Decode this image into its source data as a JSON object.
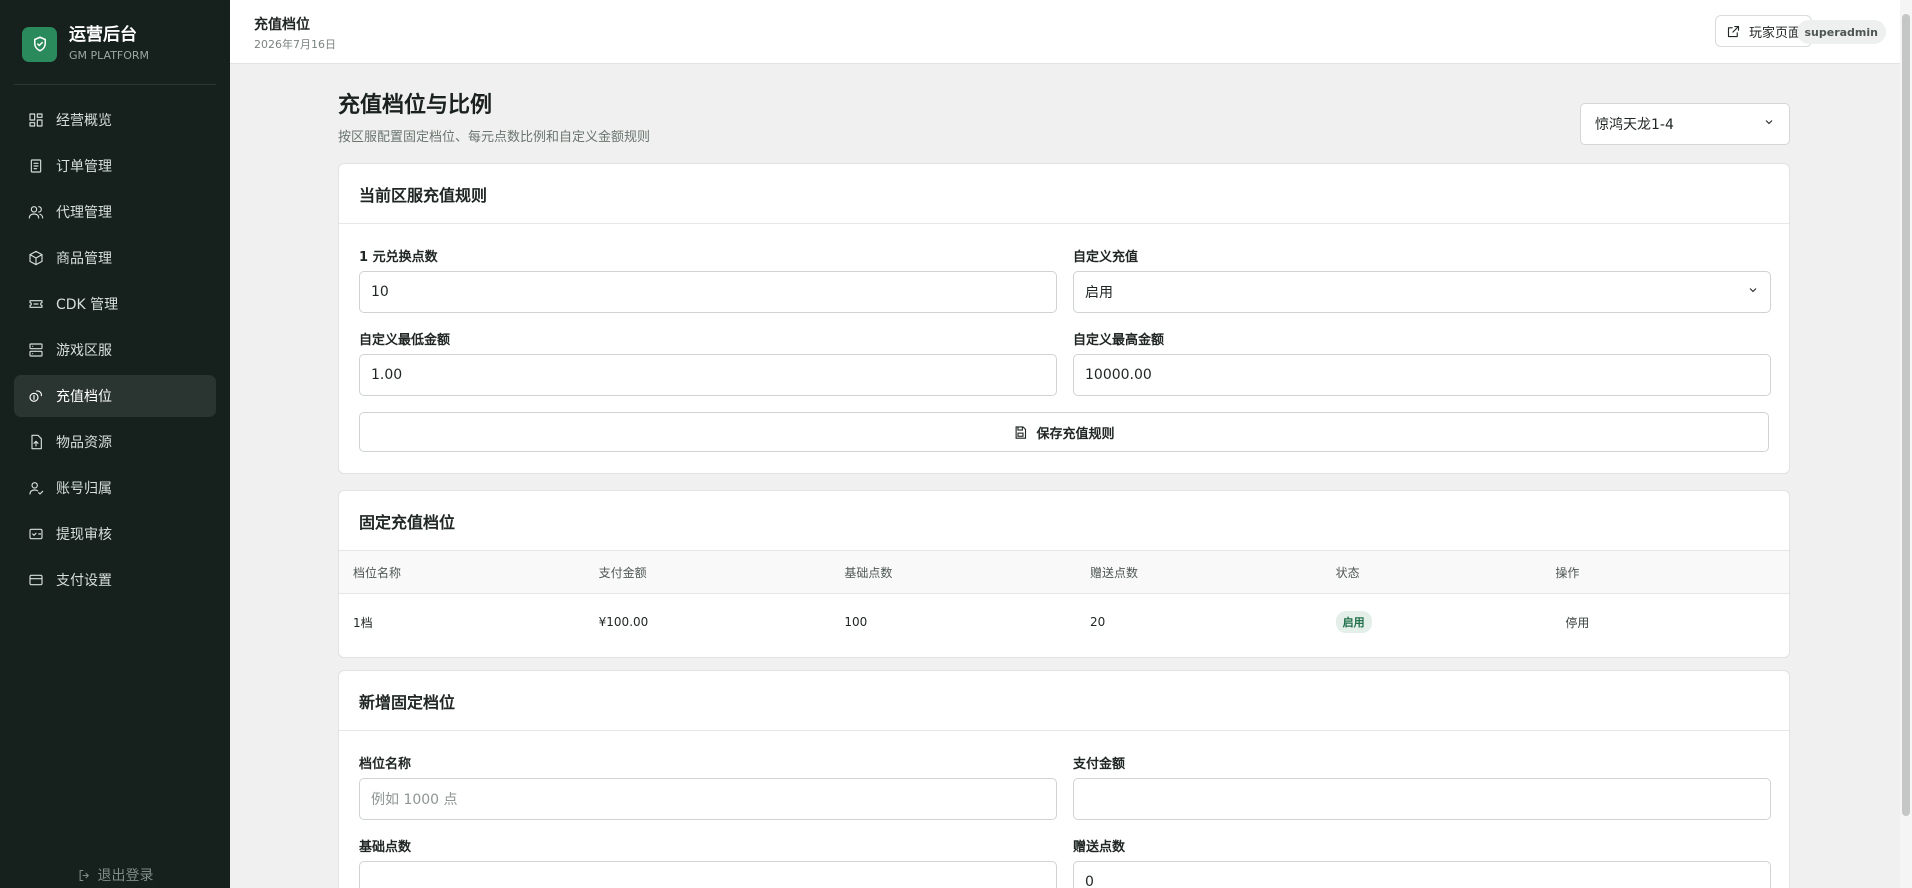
{
  "sidebar": {
    "brand_title": "运营后台",
    "brand_sub": "GM PLATFORM",
    "items": [
      {
        "label": "经营概览",
        "icon": "dashboard-icon"
      },
      {
        "label": "订单管理",
        "icon": "document-icon"
      },
      {
        "label": "代理管理",
        "icon": "users-icon"
      },
      {
        "label": "商品管理",
        "icon": "package-icon"
      },
      {
        "label": "CDK 管理",
        "icon": "ticket-icon"
      },
      {
        "label": "游戏区服",
        "icon": "server-icon"
      },
      {
        "label": "充值档位",
        "icon": "coins-icon"
      },
      {
        "label": "物品资源",
        "icon": "file-upload-icon"
      },
      {
        "label": "账号归属",
        "icon": "user-check-icon"
      },
      {
        "label": "提现审核",
        "icon": "wallet-icon"
      },
      {
        "label": "支付设置",
        "icon": "credit-card-icon"
      }
    ],
    "active_index": 6,
    "logout_label": "退出登录"
  },
  "topbar": {
    "title": "充值档位",
    "date": "2026年7月16日",
    "player_page_label": "玩家页面",
    "user": "superadmin"
  },
  "page": {
    "title": "充值档位与比例",
    "description": "按区服配置固定档位、每元点数比例和自定义金额规则",
    "server_select": "惊鸿天龙1-4"
  },
  "rules_card": {
    "title": "当前区服充值规则",
    "ratio_label": "1 元兑换点数",
    "ratio_value": "10",
    "custom_label": "自定义充值",
    "custom_value": "启用",
    "min_label": "自定义最低金额",
    "min_value": "1.00",
    "max_label": "自定义最高金额",
    "max_value": "10000.00",
    "save_label": "保存充值规则"
  },
  "tiers_card": {
    "title": "固定充值档位",
    "columns": [
      "档位名称",
      "支付金额",
      "基础点数",
      "赠送点数",
      "状态",
      "操作"
    ],
    "rows": [
      {
        "name": "1档",
        "amount": "¥100.00",
        "base": "100",
        "bonus": "20",
        "status": "启用",
        "action": "停用"
      }
    ]
  },
  "new_tier_card": {
    "title": "新增固定档位",
    "name_label": "档位名称",
    "name_placeholder": "例如 1000 点",
    "amount_label": "支付金额",
    "amount_value": "",
    "base_label": "基础点数",
    "base_value": "",
    "bonus_label": "赠送点数",
    "bonus_value": "0"
  },
  "colors": {
    "sidebar_bg": "#16201d",
    "accent": "#2b8a5c",
    "badge_bg": "#e3efe8",
    "badge_text": "#23704a"
  }
}
